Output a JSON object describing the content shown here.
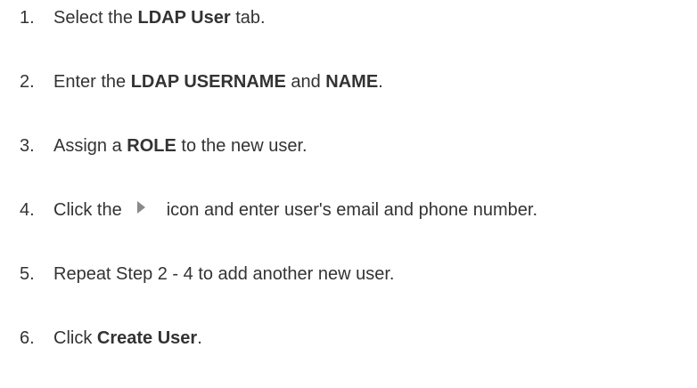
{
  "steps": [
    {
      "number": "1.",
      "pre": "Select the ",
      "bold": "LDAP User",
      "post": " tab."
    },
    {
      "number": "2.",
      "pre": "Enter the ",
      "bold1": "LDAP USERNAME",
      "mid": " and ",
      "bold2": "NAME",
      "post": "."
    },
    {
      "number": "3.",
      "pre": "Assign a ",
      "bold": "ROLE",
      "post": " to the new user."
    },
    {
      "number": "4.",
      "pre": "Click the",
      "icon": "play-triangle-icon",
      "post": "icon and enter user's email and phone number."
    },
    {
      "number": "5.",
      "text": "Repeat Step 2 - 4 to add another new user."
    },
    {
      "number": "6.",
      "pre": "Click ",
      "bold": "Create User",
      "post": "."
    }
  ],
  "colors": {
    "text": "#333333",
    "icon": "#8a8a8a",
    "background": "#ffffff"
  }
}
